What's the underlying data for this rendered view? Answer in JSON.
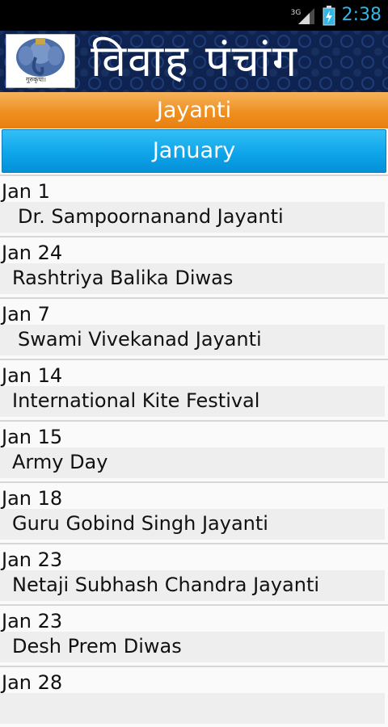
{
  "status_bar": {
    "network": "3G",
    "time": "2:38",
    "signal_icon": "signal-icon",
    "battery_icon": "battery-charging-icon"
  },
  "banner": {
    "title": "विवाह पंचांग",
    "logo_icon": "ganesha-logo-icon",
    "logo_caption": "गुरुकृपा।"
  },
  "section": {
    "category": "Jayanti",
    "month": "January"
  },
  "events": [
    {
      "date": "Jan 1",
      "name": "Dr. Sampoornanand Jayanti"
    },
    {
      "date": "Jan 24",
      "name": "Rashtriya Balika Diwas"
    },
    {
      "date": "Jan 7",
      "name": "Swami Vivekanad Jayanti"
    },
    {
      "date": "Jan 14",
      "name": "International Kite Festival"
    },
    {
      "date": "Jan 15",
      "name": "Army Day"
    },
    {
      "date": "Jan 18",
      "name": "Guru Gobind Singh Jayanti"
    },
    {
      "date": "Jan 23",
      "name": "Netaji Subhash Chandra Jayanti"
    },
    {
      "date": "Jan 23",
      "name": "Desh Prem Diwas"
    },
    {
      "date": "Jan 28",
      "name": ""
    }
  ],
  "colors": {
    "status_bar_bg": "#000000",
    "clock": "#33b5e5",
    "banner_bg": "#0e2350",
    "category_bar": "#ef9020",
    "month_bar": "#0fa5ea"
  }
}
